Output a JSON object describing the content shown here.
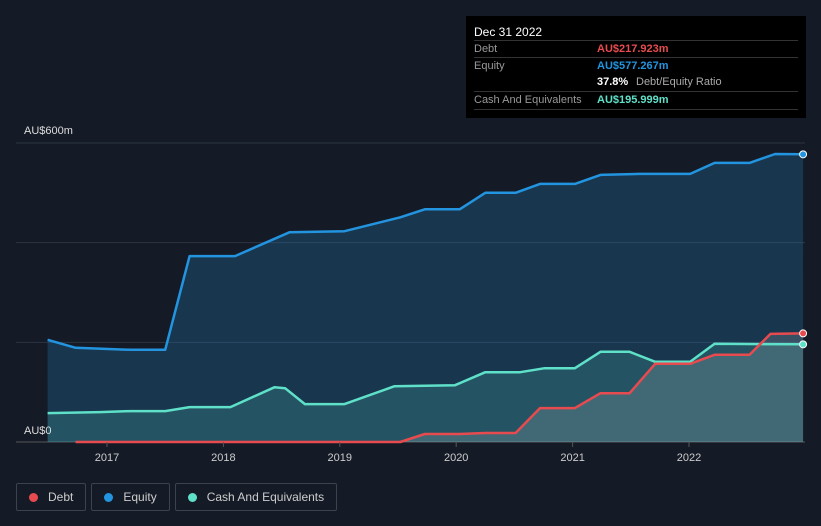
{
  "tooltip": {
    "date": "Dec 31 2022",
    "debt_label": "Debt",
    "debt_value": "AU$217.923m",
    "equity_label": "Equity",
    "equity_value": "AU$577.267m",
    "ratio_value": "37.8%",
    "ratio_label": "Debt/Equity Ratio",
    "cash_label": "Cash And Equivalents",
    "cash_value": "AU$195.999m"
  },
  "legend": [
    {
      "label": "Debt",
      "color": "#e84b4f"
    },
    {
      "label": "Equity",
      "color": "#2394df"
    },
    {
      "label": "Cash And Equivalents",
      "color": "#5fe0c8"
    }
  ],
  "chart_data": {
    "type": "area",
    "ylabel_top": "AU$600m",
    "ylabel_bottom": "AU$0",
    "ylim": [
      0,
      600
    ],
    "xlim": [
      2016.49,
      2022.99
    ],
    "xticks": [
      "2017",
      "2018",
      "2019",
      "2020",
      "2021",
      "2022"
    ],
    "series": [
      {
        "name": "Equity",
        "color": "#2394df",
        "points": [
          [
            2016.49,
            205
          ],
          [
            2016.73,
            189
          ],
          [
            2017.2,
            185
          ],
          [
            2017.5,
            185
          ],
          [
            2017.71,
            373
          ],
          [
            2018.1,
            373
          ],
          [
            2018.57,
            421
          ],
          [
            2019.04,
            423
          ],
          [
            2019.52,
            451
          ],
          [
            2019.73,
            467
          ],
          [
            2020.03,
            467
          ],
          [
            2020.25,
            500
          ],
          [
            2020.51,
            500
          ],
          [
            2020.72,
            518
          ],
          [
            2021.02,
            518
          ],
          [
            2021.24,
            536
          ],
          [
            2021.58,
            538
          ],
          [
            2022.01,
            538
          ],
          [
            2022.22,
            560
          ],
          [
            2022.52,
            560
          ],
          [
            2022.74,
            578
          ],
          [
            2022.98,
            577.267
          ]
        ]
      },
      {
        "name": "Cash And Equivalents",
        "color": "#5fe0c8",
        "points": [
          [
            2016.49,
            58
          ],
          [
            2016.94,
            60
          ],
          [
            2017.2,
            62
          ],
          [
            2017.5,
            62
          ],
          [
            2017.71,
            70
          ],
          [
            2018.06,
            70
          ],
          [
            2018.44,
            110
          ],
          [
            2018.53,
            108
          ],
          [
            2018.7,
            76
          ],
          [
            2019.04,
            76
          ],
          [
            2019.47,
            112
          ],
          [
            2019.99,
            114
          ],
          [
            2020.25,
            140
          ],
          [
            2020.55,
            140
          ],
          [
            2020.76,
            148
          ],
          [
            2021.02,
            148
          ],
          [
            2021.24,
            181
          ],
          [
            2021.49,
            181
          ],
          [
            2021.71,
            161
          ],
          [
            2022.01,
            161
          ],
          [
            2022.22,
            197
          ],
          [
            2022.98,
            195.999
          ]
        ]
      },
      {
        "name": "Debt",
        "color": "#e84b4f",
        "points": [
          [
            2016.73,
            0
          ],
          [
            2019.52,
            0
          ],
          [
            2019.73,
            16
          ],
          [
            2020.03,
            16
          ],
          [
            2020.25,
            18
          ],
          [
            2020.51,
            18
          ],
          [
            2020.72,
            68
          ],
          [
            2021.02,
            68
          ],
          [
            2021.24,
            98
          ],
          [
            2021.49,
            98
          ],
          [
            2021.71,
            157
          ],
          [
            2022.01,
            157
          ],
          [
            2022.22,
            175
          ],
          [
            2022.52,
            175
          ],
          [
            2022.7,
            217
          ],
          [
            2022.98,
            217.923
          ]
        ]
      }
    ]
  }
}
